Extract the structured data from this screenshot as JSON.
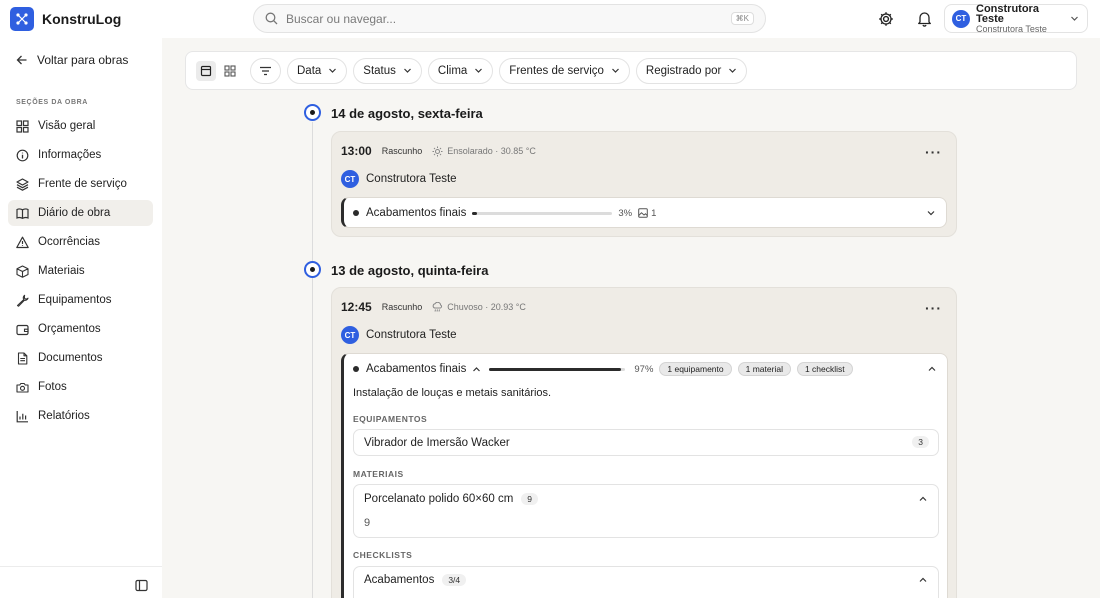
{
  "app": {
    "name": "KonstruLog",
    "brand_color": "#2f5fe0"
  },
  "search": {
    "placeholder": "Buscar ou navegar...",
    "shortcut": "⌘K"
  },
  "user": {
    "initials": "CT",
    "name": "Construtora Teste",
    "company": "Construtora Teste"
  },
  "sidebar": {
    "back_label": "Voltar para obras",
    "section_label": "SEÇÕES DA OBRA",
    "items": [
      {
        "label": "Visão geral",
        "icon": "grid-icon",
        "active": false
      },
      {
        "label": "Informações",
        "icon": "info-icon",
        "active": false
      },
      {
        "label": "Frente de serviço",
        "icon": "layers-icon",
        "active": false
      },
      {
        "label": "Diário de obra",
        "icon": "book-icon",
        "active": true
      },
      {
        "label": "Ocorrências",
        "icon": "warning-icon",
        "active": false
      },
      {
        "label": "Materiais",
        "icon": "box-icon",
        "active": false
      },
      {
        "label": "Equipamentos",
        "icon": "wrench-icon",
        "active": false
      },
      {
        "label": "Orçamentos",
        "icon": "wallet-icon",
        "active": false
      },
      {
        "label": "Documentos",
        "icon": "document-icon",
        "active": false
      },
      {
        "label": "Fotos",
        "icon": "camera-icon",
        "active": false
      },
      {
        "label": "Relatórios",
        "icon": "chart-icon",
        "active": false
      }
    ]
  },
  "filters": [
    "Data",
    "Status",
    "Clima",
    "Frentes de serviço",
    "Registrado por"
  ],
  "days": [
    {
      "title": "14 de agosto, sexta-feira",
      "entry": {
        "time": "13:00",
        "status": "Rascunho",
        "weather": "Ensolarado · 30.85 °C",
        "author": "Construtora Teste",
        "author_initials": "CT",
        "front": {
          "name": "Acabamentos finais",
          "progress": 3,
          "progress_label": "3%",
          "photos": "1"
        }
      }
    },
    {
      "title": "13 de agosto, quinta-feira",
      "entry": {
        "time": "12:45",
        "status": "Rascunho",
        "weather": "Chuvoso · 20.93 °C",
        "author": "Construtora Teste",
        "author_initials": "CT",
        "front": {
          "name": "Acabamentos finais",
          "progress": 97,
          "progress_label": "97%",
          "chips": [
            "1 equipamento",
            "1 material",
            "1 checklist"
          ],
          "description": "Instalação de louças e metais sanitários.",
          "equipment_label": "EQUIPAMENTOS",
          "equipment": {
            "name": "Vibrador de Imersão Wacker",
            "count": "3"
          },
          "materials_label": "MATERIAIS",
          "material": {
            "name": "Porcelanato polido 60×60 cm",
            "count": "9",
            "detail": "9"
          },
          "checklists_label": "CHECKLISTS",
          "checklist": {
            "name": "Acabamentos",
            "count": "3/4"
          }
        }
      }
    }
  ]
}
